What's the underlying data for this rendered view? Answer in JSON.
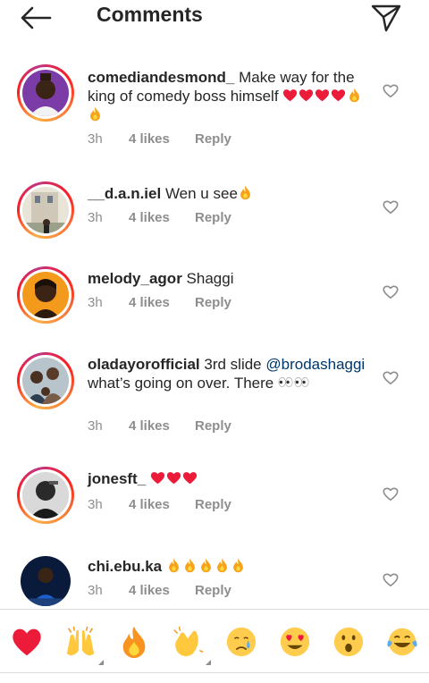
{
  "header": {
    "title": "Comments",
    "back_icon": "arrow-left-icon",
    "send_icon": "paper-plane-icon"
  },
  "comments": [
    {
      "username": "comediandesmond_",
      "text": "Make way for the king of comedy boss himself",
      "emojis_inline": [
        "red-heart",
        "red-heart",
        "red-heart",
        "red-heart",
        "fire",
        "fire"
      ],
      "time": "3h",
      "likes": "4 likes",
      "reply": "Reply"
    },
    {
      "username": "__d.a.n.iel",
      "text": "Wen u see",
      "emojis_inline": [
        "fire"
      ],
      "time": "3h",
      "likes": "4 likes",
      "reply": "Reply"
    },
    {
      "username": "melody_agor",
      "text": "Shaggi",
      "emojis_inline": [],
      "time": "3h",
      "likes": "4 likes",
      "reply": "Reply"
    },
    {
      "username": "oladayorofficial",
      "text_before": "3rd slide",
      "mention": "@brodashaggi",
      "text": "what’s going on over. There",
      "emojis_inline": [
        "eyes",
        "eyes"
      ],
      "time": "3h",
      "likes": "4 likes",
      "reply": "Reply"
    },
    {
      "username": "jonesft_",
      "text": "",
      "emojis_inline": [
        "red-heart",
        "red-heart",
        "red-heart"
      ],
      "time": "3h",
      "likes": "4 likes",
      "reply": "Reply"
    },
    {
      "username": "chi.ebu.ka",
      "text": "",
      "emojis_inline": [
        "fire",
        "fire",
        "fire",
        "fire",
        "fire"
      ],
      "time": "3h",
      "likes": "4 likes",
      "reply": "Reply"
    }
  ],
  "quick_reactions": [
    "red-heart",
    "raising-hands",
    "fire",
    "clapping-hands",
    "crying-face",
    "heart-eyes-face",
    "surprised-face",
    "tears-of-joy-face"
  ],
  "colors": {
    "heart": "#ed1b3a",
    "mention": "#00376b",
    "meta": "#8e8e8e",
    "text": "#262626"
  }
}
